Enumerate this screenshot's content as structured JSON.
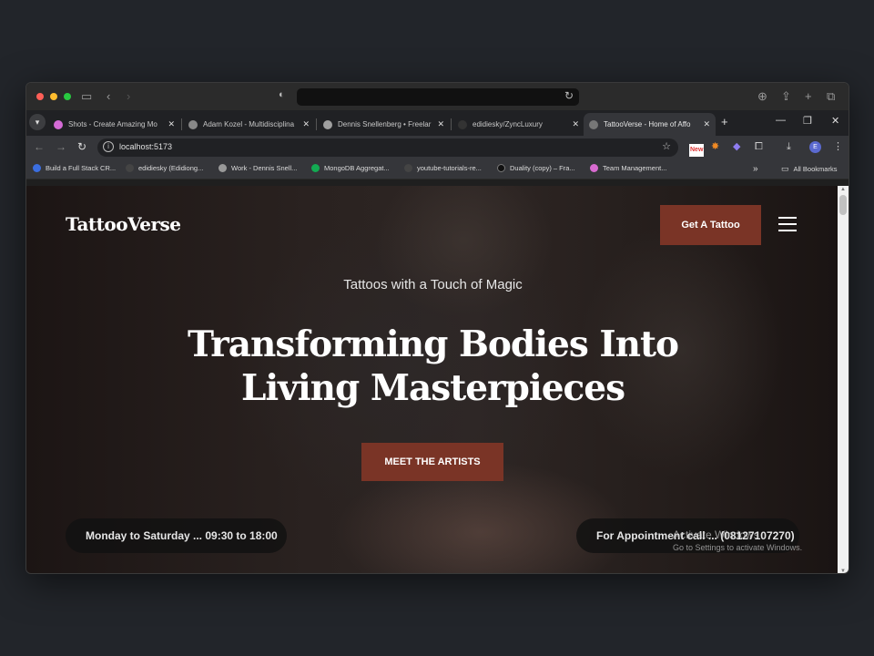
{
  "browser": {
    "address_bar_value": "",
    "tabs": [
      {
        "label": "Shots - Create Amazing Mo",
        "color": "#d46bd6"
      },
      {
        "label": "Adam Kozel - Multidisciplina",
        "color": "#888888"
      },
      {
        "label": "Dennis Snellenberg • Freelar",
        "color": "#a0a0a0"
      },
      {
        "label": "edidiesky/ZyncLuxury",
        "color": "#333333"
      },
      {
        "label": "TattooVerse - Home of Affo",
        "color": "#777777"
      }
    ],
    "url": "localhost:5173",
    "bookmarks": [
      "Build a Full Stack CR...",
      "edidiesky (Edidiong...",
      "Work - Dennis Snell...",
      "MongoDB Aggregat...",
      "youtube-tutorials-re...",
      "Duality (copy) – Fra...",
      "Team Management..."
    ],
    "all_bookmarks": "All Bookmarks",
    "more": "»",
    "profile_initial": "E",
    "ext_badge": "New"
  },
  "site": {
    "logo": "TattooVerse",
    "nav_cta": "Get A Tattoo",
    "tagline": "Tattoos with a Touch of Magic",
    "headline_line1": "Transforming Bodies Into",
    "headline_line2": "Living Masterpieces",
    "main_cta": "MEET THE ARTISTS",
    "hours": "Monday to Saturday ... 09:30 to 18:00",
    "appointment": "For Appointment call ... (08127107270)"
  },
  "os": {
    "activate_title": "Activate Windows",
    "activate_sub": "Go to Settings to activate Windows."
  },
  "colors": {
    "accent": "#7a3426",
    "page_bg": "#22252a"
  }
}
